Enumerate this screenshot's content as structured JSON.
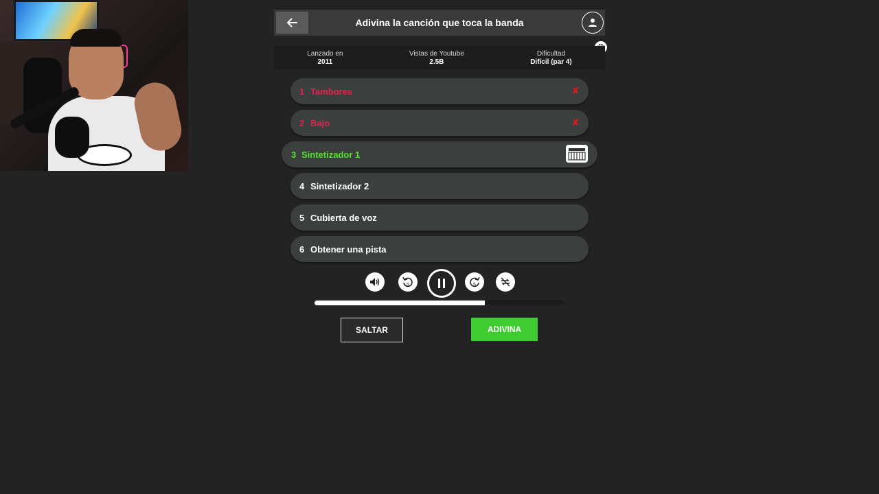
{
  "header": {
    "title": "Adivina la canción que toca la banda",
    "back_icon": "arrow-left-icon",
    "profile_icon": "user-icon"
  },
  "info": [
    {
      "label": "Lanzado en",
      "value": "2011"
    },
    {
      "label": "Vistas de Youtube",
      "value": "2.5B"
    },
    {
      "label": "Dificultad",
      "value": "Difícil (par 4)"
    }
  ],
  "tracks": [
    {
      "num": "1",
      "label": "Tambores",
      "status": "failed"
    },
    {
      "num": "2",
      "label": "Bajo",
      "status": "failed"
    },
    {
      "num": "3",
      "label": "Sintetizador 1",
      "status": "active"
    },
    {
      "num": "4",
      "label": "Sintetizador 2",
      "status": "locked"
    },
    {
      "num": "5",
      "label": "Cubierta de voz",
      "status": "locked"
    },
    {
      "num": "6",
      "label": "Obtener una pista",
      "status": "locked"
    }
  ],
  "controls": {
    "icons": [
      "volume-icon",
      "rewind-5-icon",
      "pause-icon",
      "forward-5-icon",
      "repeat-off-icon"
    ]
  },
  "progress": {
    "fraction": 0.68
  },
  "buttons": {
    "skip": "SALTAR",
    "guess": "ADIVINA"
  },
  "colors": {
    "failed": "#e2224f",
    "active": "#52e22c",
    "guess": "#3fcc31"
  }
}
